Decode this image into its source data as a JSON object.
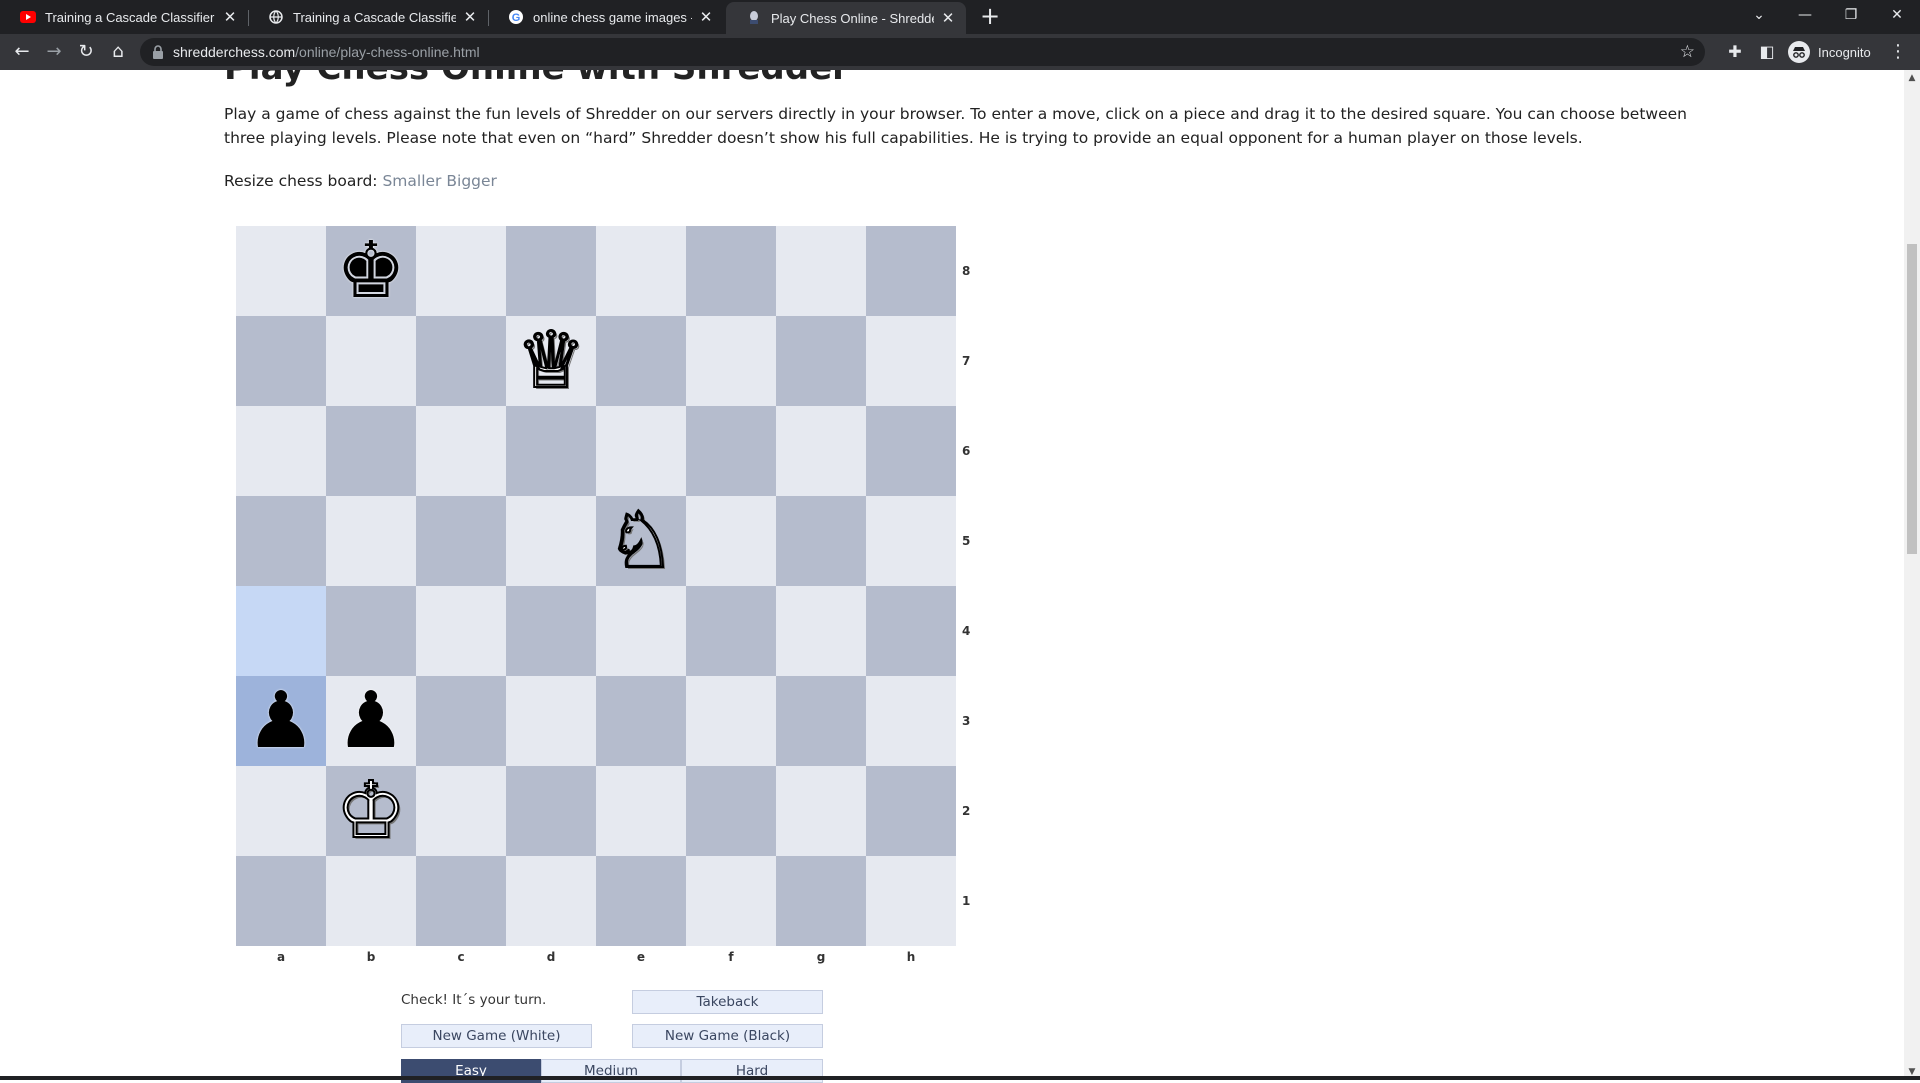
{
  "tabs": [
    {
      "title": "Training a Cascade Classifier - Op",
      "icon": "youtube-icon",
      "active": false
    },
    {
      "title": "Training a Cascade Classifier - Le",
      "icon": "globe-icon",
      "active": false
    },
    {
      "title": "online chess game images - Goo",
      "icon": "google-icon",
      "active": false
    },
    {
      "title": "Play Chess Online - Shredder Che",
      "icon": "shredder-icon",
      "active": true
    }
  ],
  "toolbar": {
    "url_host": "shredderchess.com",
    "url_path": "/online/play-chess-online.html",
    "profile_label": "Incognito"
  },
  "page": {
    "heading": "Play Chess Online with Shredder",
    "intro": "Play a game of chess against the fun levels of Shredder on our servers directly in your browser. To enter a move, click on a piece and drag it to the desired square. You can choose between three playing levels. Please note that even on “hard” Shredder doesn’t show his full capabilities. He is trying to provide an equal opponent for a human player on those levels.",
    "resize_label": "Resize chess board: ",
    "resize_smaller": "Smaller",
    "resize_bigger": "Bigger"
  },
  "board": {
    "files": [
      "a",
      "b",
      "c",
      "d",
      "e",
      "f",
      "g",
      "h"
    ],
    "ranks": [
      "8",
      "7",
      "6",
      "5",
      "4",
      "3",
      "2",
      "1"
    ],
    "highlight": [
      "a4",
      "a3"
    ],
    "pieces": [
      {
        "square": "b8",
        "piece": "king",
        "color": "black",
        "glyph": "♚"
      },
      {
        "square": "d7",
        "piece": "queen",
        "color": "white",
        "glyph": "♕"
      },
      {
        "square": "e5",
        "piece": "knight",
        "color": "white",
        "glyph": "♘"
      },
      {
        "square": "a3",
        "piece": "pawn",
        "color": "black",
        "glyph": "♟"
      },
      {
        "square": "b3",
        "piece": "pawn",
        "color": "black",
        "glyph": "♟"
      },
      {
        "square": "b2",
        "piece": "king",
        "color": "white",
        "glyph": "♔"
      }
    ]
  },
  "game": {
    "status": "Check! It´s your turn.",
    "takeback": "Takeback",
    "new_white": "New Game (White)",
    "new_black": "New Game (Black)",
    "levels": [
      "Easy",
      "Medium",
      "Hard"
    ],
    "selected_level": "Easy"
  }
}
